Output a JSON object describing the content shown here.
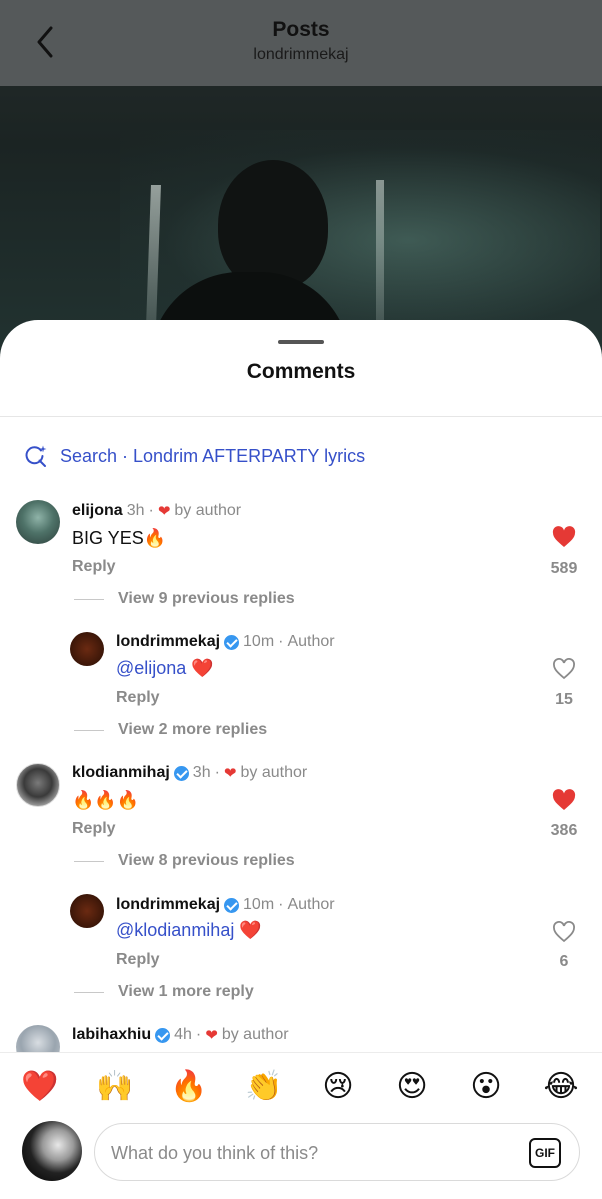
{
  "header": {
    "title": "Posts",
    "username": "londrimmekaj"
  },
  "sheet": {
    "title": "Comments"
  },
  "search": {
    "label": "Search · Londrim AFTERPARTY lyrics"
  },
  "comments": [
    {
      "user": "elijona",
      "time": "3h",
      "tag": "by author",
      "text": "BIG YES🔥",
      "reply_label": "Reply",
      "likes": "589",
      "view_label": "View 9 previous replies"
    },
    {
      "user": "londrimmekaj",
      "time": "10m",
      "tag": "Author",
      "mention": "@elijona",
      "text": " ❤️",
      "reply_label": "Reply",
      "likes": "15",
      "view_label": "View 2 more replies"
    },
    {
      "user": "klodianmihaj",
      "time": "3h",
      "tag": "by author",
      "text": "🔥🔥🔥",
      "reply_label": "Reply",
      "likes": "386",
      "view_label": "View 8 previous replies"
    },
    {
      "user": "londrimmekaj",
      "time": "10m",
      "tag": "Author",
      "mention": "@klodianmihaj",
      "text": " ❤️",
      "reply_label": "Reply",
      "likes": "6",
      "view_label": "View 1 more reply"
    },
    {
      "user": "labihaxhiu",
      "time": "4h",
      "tag": "by author"
    }
  ],
  "separator": "·",
  "emoji_bar": [
    "❤️",
    "🙌",
    "🔥",
    "👏",
    "😢",
    "😍",
    "😮",
    "😂"
  ],
  "composer": {
    "placeholder": "What do you think of this?",
    "gif_label": "GIF"
  },
  "colors": {
    "accent": "#3650c9",
    "like": "#e53935",
    "verified": "#3797f0"
  }
}
